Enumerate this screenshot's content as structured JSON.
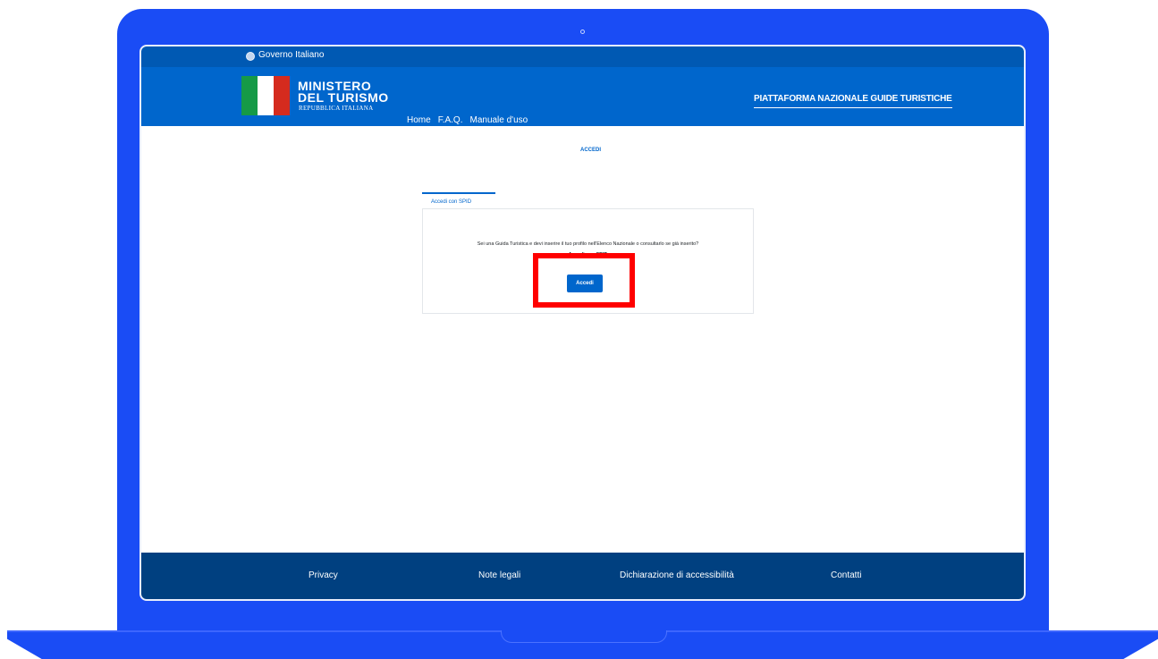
{
  "gov_bar": {
    "label": "Governo Italiano"
  },
  "header": {
    "ministry_line1": "MINISTERO",
    "ministry_line2": "DEL TURISMO",
    "ministry_sub": "REPUBBLICA ITALIANA",
    "platform_title": "PIATTAFORMA NAZIONALE GUIDE TURISTICHE",
    "nav": [
      {
        "label": "Home",
        "active": true
      },
      {
        "label": "F.A.Q."
      },
      {
        "label": "Manuale d'uso"
      }
    ]
  },
  "main": {
    "accedi_link": "ACCEDI",
    "tab_label": "Accedi con SPID",
    "question": "Sei una Guida Turistica e devi inserire il tuo profilo nell'Elenco Nazionale o consultarlo se già inserito?",
    "sub_question": "Accedi con SPID",
    "button_label": "Accedi"
  },
  "footer": {
    "links": [
      "Privacy",
      "Note legali",
      "Dichiarazione di accessibilità",
      "Contatti"
    ]
  },
  "colors": {
    "frame": "#1a4cf5",
    "header": "#0066cc",
    "gov_bar": "#0059b3",
    "footer": "#004080",
    "highlight": "#ff0000"
  }
}
